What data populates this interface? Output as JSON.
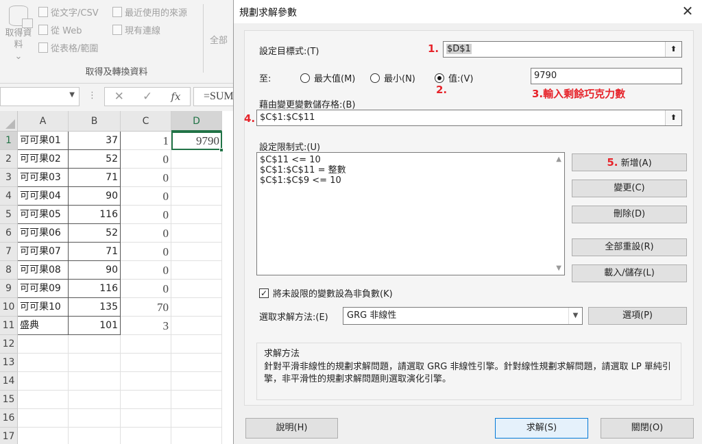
{
  "ribbon": {
    "get_data_label": "取得資料",
    "from_text_csv": "從文字/CSV",
    "from_web": "從 Web",
    "from_table": "從表格/範圍",
    "recent_sources": "最近使用的來源",
    "existing_connections": "現有連線",
    "group_caption": "取得及轉換資料",
    "all_label": "全部"
  },
  "formula_bar": {
    "name_box": "",
    "dots": "⋮",
    "cancel_glyph": "✕",
    "enter_glyph": "✓",
    "fx": "fx",
    "formula": "=SUM"
  },
  "sheet": {
    "columns": [
      "A",
      "B",
      "C",
      "D"
    ],
    "rows": [
      {
        "num": "1",
        "a": "可可果01",
        "b": "37",
        "c": "1",
        "d": "9790"
      },
      {
        "num": "2",
        "a": "可可果02",
        "b": "52",
        "c": "0",
        "d": ""
      },
      {
        "num": "3",
        "a": "可可果03",
        "b": "71",
        "c": "0",
        "d": ""
      },
      {
        "num": "4",
        "a": "可可果04",
        "b": "90",
        "c": "0",
        "d": ""
      },
      {
        "num": "5",
        "a": "可可果05",
        "b": "116",
        "c": "0",
        "d": ""
      },
      {
        "num": "6",
        "a": "可可果06",
        "b": "52",
        "c": "0",
        "d": ""
      },
      {
        "num": "7",
        "a": "可可果07",
        "b": "71",
        "c": "0",
        "d": ""
      },
      {
        "num": "8",
        "a": "可可果08",
        "b": "90",
        "c": "0",
        "d": ""
      },
      {
        "num": "9",
        "a": "可可果09",
        "b": "116",
        "c": "0",
        "d": ""
      },
      {
        "num": "10",
        "a": "可可果10",
        "b": "135",
        "c": "70",
        "d": ""
      },
      {
        "num": "11",
        "a": "盛典",
        "b": "101",
        "c": "3",
        "d": ""
      },
      {
        "num": "12",
        "a": "",
        "b": "",
        "c": "",
        "d": ""
      },
      {
        "num": "13",
        "a": "",
        "b": "",
        "c": "",
        "d": ""
      },
      {
        "num": "14",
        "a": "",
        "b": "",
        "c": "",
        "d": ""
      },
      {
        "num": "15",
        "a": "",
        "b": "",
        "c": "",
        "d": ""
      },
      {
        "num": "16",
        "a": "",
        "b": "",
        "c": "",
        "d": ""
      },
      {
        "num": "17",
        "a": "",
        "b": "",
        "c": "",
        "d": ""
      }
    ]
  },
  "dialog": {
    "title": "規劃求解參數",
    "close_glyph": "✕",
    "objective_label": "設定目標式:(T)",
    "objective_value": "$D$1",
    "to_label": "至:",
    "max_label": "最大值(M)",
    "min_label": "最小(N)",
    "value_label": "值:(V)",
    "value_input": "9790",
    "changing_label": "藉由變更變數儲存格:(B)",
    "changing_value": "$C$1:$C$11",
    "constraints_label": "設定限制式:(U)",
    "constraints": [
      "$C$11 <= 10",
      "$C$1:$C$11 = 整數",
      "$C$1:$C$9 <= 10"
    ],
    "add_button": "新增(A)",
    "change_button": "變更(C)",
    "delete_button": "刪除(D)",
    "reset_all_button": "全部重設(R)",
    "load_save_button": "載入/儲存(L)",
    "nonneg_label": "將未設限的變數設為非負數(K)",
    "method_label": "選取求解方法:(E)",
    "method_value": "GRG 非線性",
    "options_button": "選項(P)",
    "desc_head": "求解方法",
    "desc_text": "針對平滑非線性的規劃求解問題，請選取 GRG 非線性引擎。針對線性規劃求解問題，請選取 LP 單純引擎，非平滑性的規劃求解問題則選取演化引擎。",
    "help_button": "說明(H)",
    "solve_button": "求解(S)",
    "close_button": "關閉(O)",
    "range_icon_glyph": "⬆"
  },
  "annotations": {
    "a1": "1.",
    "a2": "2.",
    "a3": "3.輸入剩餘巧克力數",
    "a4": "4.",
    "a5": "5."
  },
  "colors": {
    "annotation_red": "#e6232a",
    "excel_green": "#217346"
  }
}
